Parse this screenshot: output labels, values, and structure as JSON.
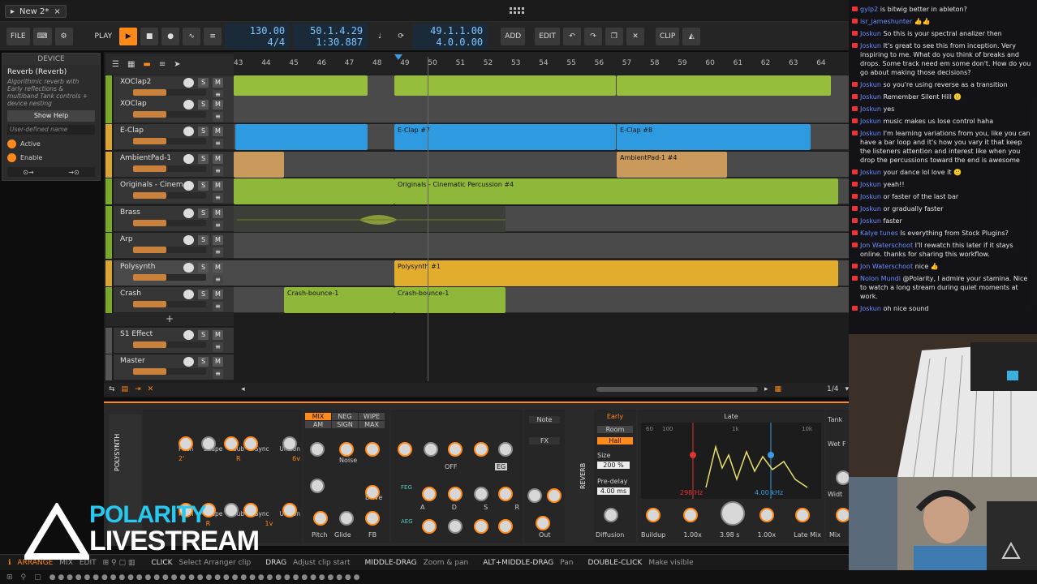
{
  "window": {
    "doc_tab": "New 2*",
    "close_glyph": "×",
    "menu_glyph": "▸"
  },
  "toolbar": {
    "file": "FILE",
    "play_label": "PLAY",
    "tempo": "130.00",
    "signature": "4/4",
    "position_bars": "50.1.4.29",
    "position_time": "1:30.887",
    "loop_start": "49.1.1.00",
    "loop_length": "4.0.0.00",
    "add": "ADD",
    "edit": "EDIT",
    "clip": "CLIP"
  },
  "device": {
    "header": "DEVICE",
    "name": "Reverb (Reverb)",
    "description": "Algorithmic reverb with Early reflections & multiband Tank controls + device nesting",
    "show_help": "Show Help",
    "user_defined": "User-defined name",
    "active": "Active",
    "enable": "Enable"
  },
  "ruler": [
    "43",
    "44",
    "45",
    "46",
    "47",
    "48",
    "49",
    "50",
    "51",
    "52",
    "53",
    "54",
    "55",
    "56",
    "57",
    "58",
    "59",
    "60",
    "61",
    "62",
    "63",
    "64"
  ],
  "tracks": [
    {
      "name": "XOClap2",
      "color": "#7aa82d",
      "fill": 0.45
    },
    {
      "name": "XOClap",
      "color": "#7aa82d",
      "fill": 0.45
    },
    {
      "name": "E-Clap",
      "color": "#d9a534",
      "fill": 0.45
    },
    {
      "name": "AmbientPad-1",
      "color": "#d9a534",
      "fill": 0.45
    },
    {
      "name": "Originals - Cinema...",
      "color": "#7aa82d",
      "fill": 0.45
    },
    {
      "name": "Brass",
      "color": "#7aa82d",
      "fill": 0.45
    },
    {
      "name": "Arp",
      "color": "#7aa82d",
      "fill": 0.45
    },
    {
      "name": "Polysynth",
      "color": "#d9a534",
      "fill": 0.45
    },
    {
      "name": "Crash",
      "color": "#7aa82d",
      "fill": 0.45
    },
    {
      "name": "S1 Effect",
      "color": "#555555",
      "fill": 0.45
    },
    {
      "name": "Master",
      "color": "#555555",
      "fill": 0.45
    }
  ],
  "clips": {
    "eclap7": "E-Clap #7",
    "eclap8": "E-Clap #8",
    "ambient4": "AmbientPad-1 #4",
    "originals4": "Originals - Cinematic Percussion #4",
    "polysynth1": "Polysynth #1",
    "crash_a": "Crash-bounce-1",
    "crash_b": "Crash-bounce-1"
  },
  "arranger_footer": {
    "zoom": "1/4"
  },
  "chain": {
    "device_name": "POLYSYNTH",
    "osc_labels": [
      "Pitch",
      "Shape",
      "Sub",
      "Sync",
      "Unison"
    ],
    "osc_values": [
      "2'",
      "6v",
      "R"
    ],
    "osc2_values": [
      "1v",
      "R"
    ],
    "mix": [
      "MIX",
      "NEG",
      "WIPE",
      "AM",
      "SIGN",
      "MAX"
    ],
    "noise": "Noise",
    "drive": "Drive",
    "pitch": "Pitch",
    "glide": "Glide",
    "fb": "FB",
    "filter_off": "OFF",
    "eg": "EG",
    "feg": "FEG",
    "aeg": "AEG",
    "adsr": [
      "A",
      "D",
      "S",
      "R"
    ],
    "note": "Note",
    "fx": "FX",
    "out": "Out",
    "reverb_name": "REVERB",
    "early": "Early",
    "room": "Room",
    "hall": "Hall",
    "size_label": "Size",
    "size_value": "200 %",
    "predelay_label": "Pre-delay",
    "predelay_value": "4.00 ms",
    "diffusion": "Diffusion",
    "late": "Late",
    "freq_low": "298 Hz",
    "freq_high": "4.00 kHz",
    "late_knobs": [
      "Buildup",
      "1.00x",
      "3.98 s",
      "1.00x",
      "Late Mix"
    ],
    "tank": "Tank",
    "wet": "Wet F",
    "width": "Widt",
    "mix_short": "Mix",
    "scale": [
      "60",
      "100",
      "1k",
      "10k"
    ]
  },
  "statusbar": {
    "tabs": [
      "ARRANGE",
      "MIX",
      "EDIT"
    ],
    "hints": [
      {
        "key": "CLICK",
        "desc": "Select Arranger clip"
      },
      {
        "key": "DRAG",
        "desc": "Adjust clip start"
      },
      {
        "key": "MIDDLE-DRAG",
        "desc": "Zoom & pan"
      },
      {
        "key": "ALT+MIDDLE-DRAG",
        "desc": "Pan"
      },
      {
        "key": "DOUBLE-CLICK",
        "desc": "Make visible"
      }
    ]
  },
  "chat": [
    {
      "user": "gylp2",
      "text": "is bitwig better in ableton?"
    },
    {
      "user": "isr_jameshunter",
      "text": "👍👍"
    },
    {
      "user": "Joskun",
      "text": "So this is your spectral analizer then"
    },
    {
      "user": "Joskun",
      "text": "It's great to see this from inception. Very inspiring to me. What do you think of breaks and drops. Some track need em some don't. How do you go about making those decisions?"
    },
    {
      "user": "Joskun",
      "text": "so you're using reverse as a transition"
    },
    {
      "user": "Joskun",
      "text": "Remember Silent Hill 🙂"
    },
    {
      "user": "Joskun",
      "text": "yes"
    },
    {
      "user": "Joskun",
      "text": "music makes us lose control haha"
    },
    {
      "user": "Joskun",
      "text": "I'm learning variations from you, like you can have a bar loop and it's how you vary it that keep the listeners attention and interest like when you drop the percussions toward the end is awesome"
    },
    {
      "user": "Joskun",
      "text": "your dance lol love it 🙂"
    },
    {
      "user": "Joskun",
      "text": "yeah!!"
    },
    {
      "user": "Joskun",
      "text": "or faster of the last bar"
    },
    {
      "user": "Joskun",
      "text": "or gradually faster"
    },
    {
      "user": "Joskun",
      "text": "faster"
    },
    {
      "user": "Kalye tunes",
      "text": "Is everything from Stock Plugins?"
    },
    {
      "user": "Jon Waterschoot",
      "text": "I'll rewatch this later if it stays online. thanks for sharing this workflow."
    },
    {
      "user": "Jon Waterschoot",
      "text": "nice 👍"
    },
    {
      "user": "Nolon Mundi",
      "text": "@Polarity, I admire your stamina. Nice to watch a long stream during quiet moments at work."
    },
    {
      "user": "Joskun",
      "text": "oh nice sound"
    }
  ],
  "logo": {
    "line1": "POLARITY",
    "line2": "LIVESTREAM"
  }
}
